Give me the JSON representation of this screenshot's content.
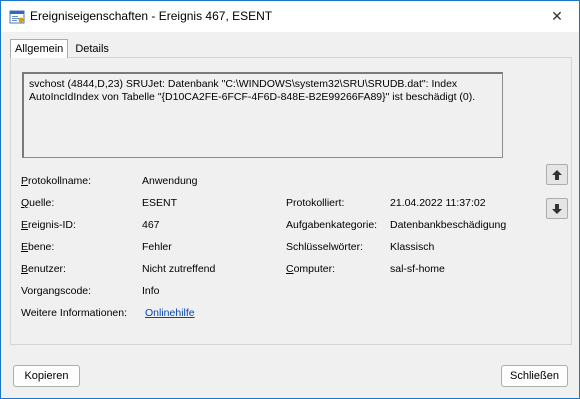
{
  "window": {
    "title": "Ereigniseigenschaften - Ereignis 467, ESENT",
    "close_glyph": "✕"
  },
  "tabs": [
    {
      "label": "Allgemein",
      "active": true
    },
    {
      "label": "Details",
      "active": false
    }
  ],
  "description": "svchost (4844,D,23) SRUJet: Datenbank \"C:\\WINDOWS\\system32\\SRU\\SRUDB.dat\": Index AutoIncIdIndex von Tabelle \"{D10CA2FE-6FCF-4F6D-848E-B2E99266FA89}\" ist beschädigt (0).",
  "fields": {
    "protokollname": {
      "label_u": "P",
      "label_rest": "rotokollname:",
      "value": "Anwendung"
    },
    "quelle": {
      "label_u": "Q",
      "label_rest": "uelle:",
      "value": "ESENT"
    },
    "ereignis_id": {
      "label_u": "E",
      "label_rest": "reignis-ID:",
      "value": "467"
    },
    "ebene": {
      "label_u": "E",
      "label_rest": "bene:",
      "value": "Fehler"
    },
    "benutzer": {
      "label_u": "B",
      "label_rest": "enutzer:",
      "value": "Nicht zutreffend"
    },
    "vorgangscode": {
      "label": "Vorgangscode:",
      "value": "Info"
    },
    "weitere_info": {
      "label": "Weitere Informationen:",
      "link": "Onlinehilfe"
    },
    "protokolliert": {
      "label": "Protokolliert:",
      "value": "21.04.2022 11:37:02"
    },
    "aufgabenkategorie": {
      "label": "Aufgabenkategorie:",
      "value": "Datenbankbeschädigung"
    },
    "schluesselwoerter": {
      "label": "Schlüsselwörter:",
      "value": "Klassisch"
    },
    "computer": {
      "label_u": "C",
      "label_rest": "omputer:",
      "value": "sal-sf-home"
    }
  },
  "buttons": {
    "kopieren": "Kopieren",
    "schliessen": "Schließen"
  },
  "icons": {
    "up": "arrow-up-icon",
    "down": "arrow-down-icon"
  }
}
